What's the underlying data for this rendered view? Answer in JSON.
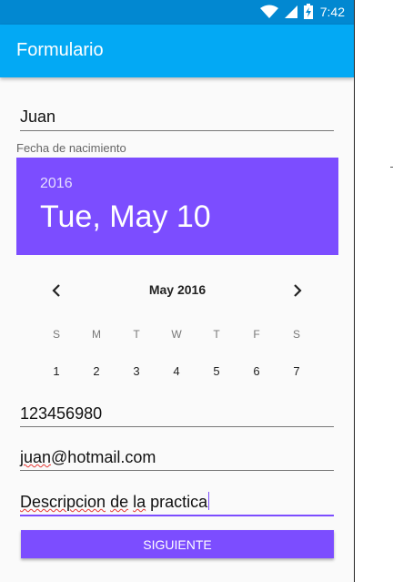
{
  "status_bar": {
    "time": "7:42"
  },
  "app_bar": {
    "title": "Formulario"
  },
  "form": {
    "name_value": "Juan",
    "birthdate_label": "Fecha de nacimiento",
    "phone_value": "123456980",
    "email_value": [
      "juan",
      "@hotmail.com"
    ],
    "description_value": [
      "Descripcion",
      " ",
      "de",
      " ",
      "la",
      " practica"
    ],
    "submit_label": "SIGUIENTE"
  },
  "date_picker": {
    "year": "2016",
    "selected_date": "Tue, May 10",
    "month_label": "May 2016",
    "weekdays": [
      "S",
      "M",
      "T",
      "W",
      "T",
      "F",
      "S"
    ],
    "days": [
      "1",
      "2",
      "3",
      "4",
      "5",
      "6",
      "7"
    ]
  },
  "colors": {
    "status_bar": "#0288d1",
    "app_bar": "#03a9f4",
    "accent": "#7c4dff"
  },
  "icons": [
    "wifi-icon",
    "cell-signal-icon",
    "battery-charging-icon",
    "chevron-left-icon",
    "chevron-right-icon"
  ]
}
